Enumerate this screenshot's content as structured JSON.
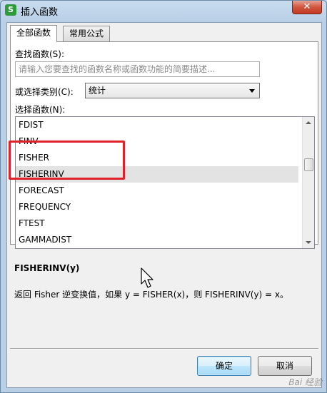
{
  "window": {
    "title": "插入函数",
    "app_icon_letter": "S",
    "close_glyph": "✕"
  },
  "tabs": [
    {
      "label": "全部函数",
      "active": true
    },
    {
      "label": "常用公式",
      "active": false
    }
  ],
  "search": {
    "label": "查找函数(S):",
    "placeholder": "请输入您要查找的函数名称或函数功能的简要描述...",
    "value": ""
  },
  "category": {
    "label": "或选择类别(C):",
    "selected": "统计"
  },
  "function_list": {
    "label": "选择函数(N):",
    "items": [
      "FDIST",
      "FINV",
      "FISHER",
      "FISHERINV",
      "FORECAST",
      "FREQUENCY",
      "FTEST",
      "GAMMADIST"
    ],
    "selected": "FISHERINV"
  },
  "detail": {
    "signature": "FISHERINV(y)",
    "description": "返回 Fisher 逆变换值，如果 y = FISHER(x)，则 FISHERINV(y) = x。"
  },
  "buttons": {
    "ok": "确定",
    "cancel": "取消"
  },
  "watermark": "Bai 经验",
  "colors": {
    "highlight": "#e0202a",
    "app_icon": "#2f9a3b",
    "selected_row": "#e3e3e3"
  }
}
